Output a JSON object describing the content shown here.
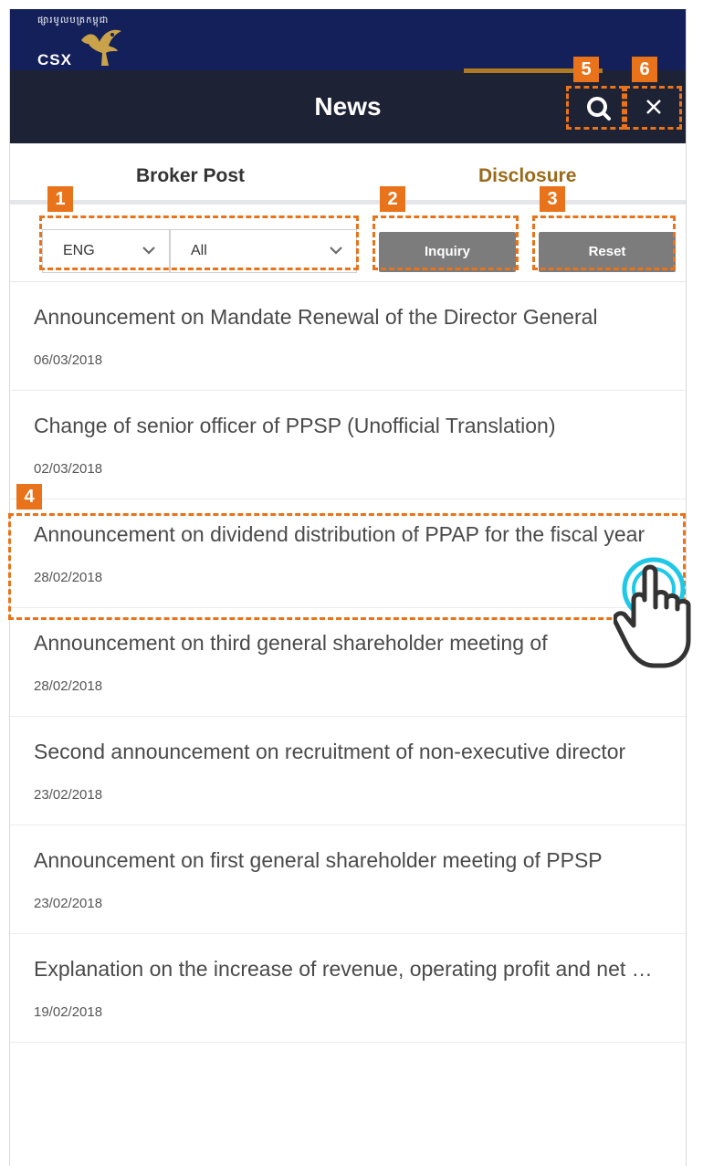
{
  "brand": {
    "khmer_name": "ផ្សារមូលបត្រកម្ពុជា",
    "short_name": "CSX"
  },
  "header": {
    "title": "News"
  },
  "tabs": [
    {
      "label": "Broker Post",
      "active": false
    },
    {
      "label": "Disclosure",
      "active": true
    }
  ],
  "filters": {
    "language_value": "ENG",
    "category_value": "All",
    "inquiry_label": "Inquiry",
    "reset_label": "Reset"
  },
  "news": [
    {
      "title": "Announcement on Mandate Renewal of the Director General",
      "date": "06/03/2018"
    },
    {
      "title": "Change of senior officer of PPSP (Unofficial Translation)",
      "date": "02/03/2018"
    },
    {
      "title": "Announcement on dividend distribution of PPAP for the fiscal year",
      "date": "28/02/2018"
    },
    {
      "title": "Announcement on third general shareholder meeting of",
      "date": "28/02/2018"
    },
    {
      "title": "Second announcement on recruitment of non-executive director",
      "date": "23/02/2018"
    },
    {
      "title": "Announcement on first general shareholder meeting of PPSP",
      "date": "23/02/2018"
    },
    {
      "title": "Explanation on the increase of revenue, operating profit and net profit",
      "date": "19/02/2018"
    }
  ],
  "callouts": [
    "1",
    "2",
    "3",
    "4",
    "5",
    "6"
  ],
  "colors": {
    "brand_navy": "#14205a",
    "header_dark": "#1e2235",
    "accent_gold": "#b07a20",
    "callout_orange": "#e8731a",
    "button_gray": "#7c7c7c",
    "tap_cyan": "#1ec8e6"
  },
  "icons": [
    "search-icon",
    "close-icon",
    "chevron-down-icon",
    "pointing-hand-icon",
    "bird-logo-icon"
  ]
}
